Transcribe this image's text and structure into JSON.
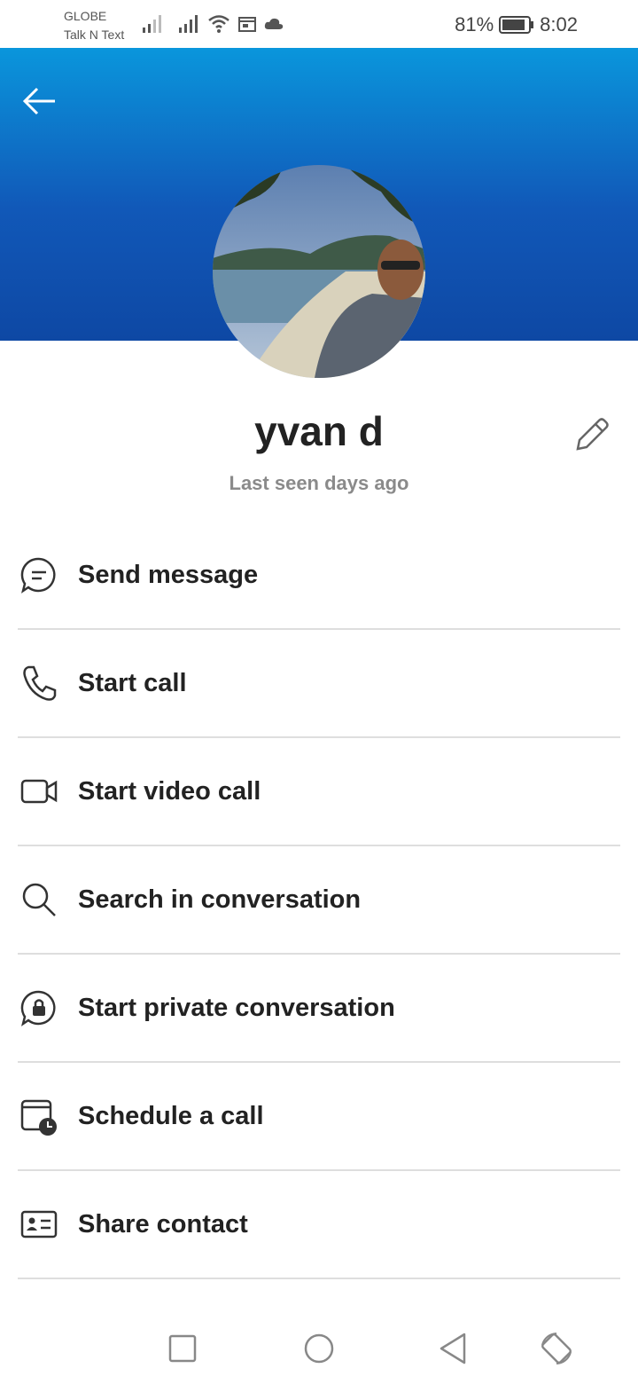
{
  "status_bar": {
    "carrier_line1": "GLOBE",
    "carrier_line2": "Talk N Text",
    "battery": "81%",
    "time": "8:02",
    "icons": [
      "signal-icon",
      "signal-icon",
      "wifi-icon",
      "calendar-icon",
      "cloud-icon",
      "battery-icon"
    ]
  },
  "header": {
    "back_icon": "arrow-left-icon",
    "gradient_top": "#0a96dc",
    "gradient_bottom": "#0e48a4"
  },
  "profile": {
    "name": "yvan d",
    "status": "Last seen days ago",
    "edit_icon": "pencil-icon"
  },
  "actions": [
    {
      "label": "Send message",
      "icon": "chat-bubble-icon"
    },
    {
      "label": "Start call",
      "icon": "phone-icon"
    },
    {
      "label": "Start video call",
      "icon": "video-camera-icon"
    },
    {
      "label": "Search in conversation",
      "icon": "search-icon"
    },
    {
      "label": "Start private conversation",
      "icon": "lock-chat-icon"
    },
    {
      "label": "Schedule a call",
      "icon": "calendar-clock-icon"
    },
    {
      "label": "Share contact",
      "icon": "contact-card-icon"
    }
  ],
  "nav_bar": {
    "icons": [
      "recents-square-icon",
      "home-circle-icon",
      "back-triangle-icon",
      "rotate-icon"
    ]
  }
}
